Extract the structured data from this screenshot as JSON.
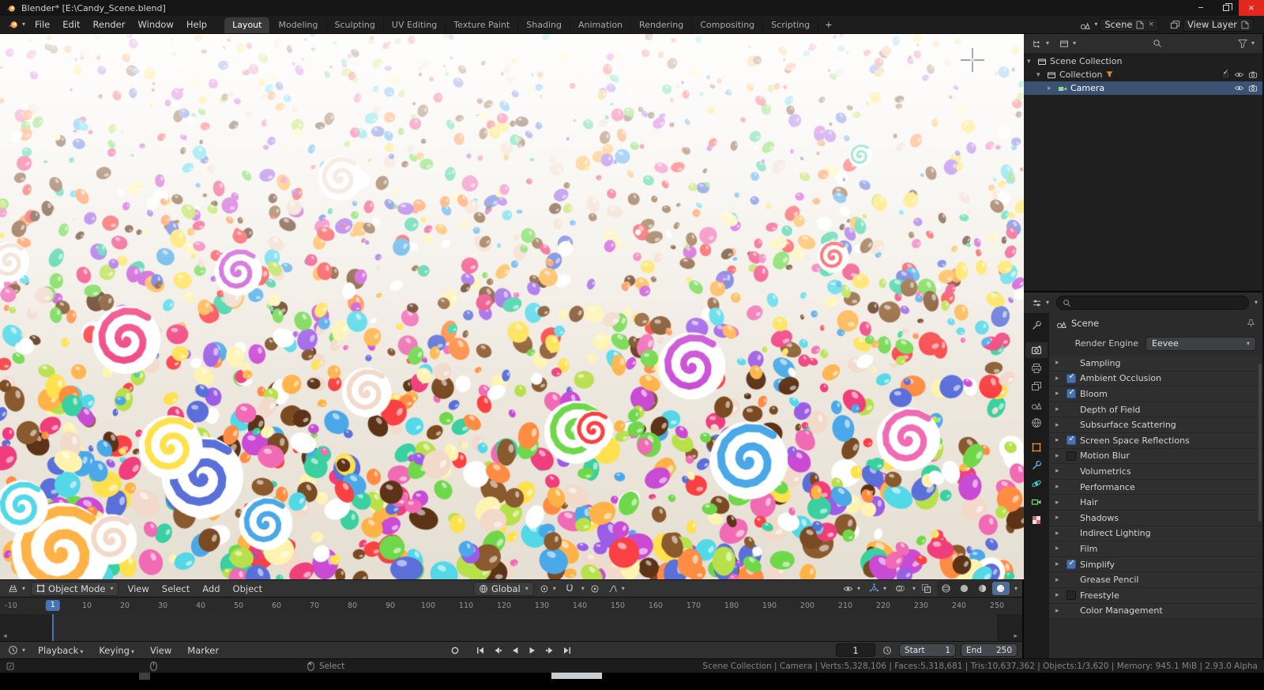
{
  "titlebar": {
    "title": "Blender*  [E:\\Candy_Scene.blend]"
  },
  "menubar": {
    "menus": [
      "File",
      "Edit",
      "Render",
      "Window",
      "Help"
    ],
    "workspaces": [
      {
        "label": "Layout",
        "active": true
      },
      {
        "label": "Modeling"
      },
      {
        "label": "Sculpting"
      },
      {
        "label": "UV Editing"
      },
      {
        "label": "Texture Paint"
      },
      {
        "label": "Shading"
      },
      {
        "label": "Animation"
      },
      {
        "label": "Rendering"
      },
      {
        "label": "Compositing"
      },
      {
        "label": "Scripting"
      }
    ],
    "add_workspace": "+",
    "scene_label": "Scene",
    "view_layer_label": "View Layer"
  },
  "viewport": {
    "header": {
      "mode": "Object Mode",
      "menus": [
        "View",
        "Select",
        "Add",
        "Object"
      ],
      "orientation": "Global"
    },
    "candy_colors": [
      "#ffffff",
      "#fff3b0",
      "#ffe14d",
      "#ffb347",
      "#ff8c42",
      "#f94144",
      "#ef3e7b",
      "#f06bb3",
      "#c94bd4",
      "#9b5de5",
      "#5a6fd8",
      "#4aa8e8",
      "#53d8e8",
      "#3ad0a0",
      "#6fd84a",
      "#b8e04a",
      "#7a4a21",
      "#5d3317",
      "#8a5a2e",
      "#f2d9c9"
    ]
  },
  "timeline": {
    "ticks": [
      -10,
      10,
      20,
      30,
      40,
      50,
      60,
      70,
      80,
      90,
      100,
      110,
      120,
      130,
      140,
      150,
      160,
      170,
      180,
      190,
      200,
      210,
      220,
      230,
      240,
      250
    ],
    "current_frame": 1,
    "frame_display": "1",
    "menus": [
      "Playback",
      "Keying",
      "View",
      "Marker"
    ],
    "start_label": "Start",
    "start_value": "1",
    "end_label": "End",
    "end_value": "250"
  },
  "outliner": {
    "rows": [
      {
        "label": "Scene Collection"
      },
      {
        "label": "Collection"
      },
      {
        "label": "Camera",
        "selected": true
      }
    ]
  },
  "properties": {
    "tabs": [
      "tool",
      "render",
      "output",
      "view-layer",
      "scene",
      "world",
      "object",
      "modifier",
      "physics",
      "object-data",
      "texture"
    ],
    "active_tab": "render",
    "breadcrumb": "Scene",
    "render_engine_label": "Render Engine",
    "render_engine": "Eevee",
    "sections": [
      {
        "label": "Sampling",
        "check": "none"
      },
      {
        "label": "Ambient Occlusion",
        "check": "checked"
      },
      {
        "label": "Bloom",
        "check": "checked"
      },
      {
        "label": "Depth of Field",
        "check": "none"
      },
      {
        "label": "Subsurface Scattering",
        "check": "none"
      },
      {
        "label": "Screen Space Reflections",
        "check": "checked"
      },
      {
        "label": "Motion Blur",
        "check": "unchecked"
      },
      {
        "label": "Volumetrics",
        "check": "none"
      },
      {
        "label": "Performance",
        "check": "none"
      },
      {
        "label": "Hair",
        "check": "none"
      },
      {
        "label": "Shadows",
        "check": "none"
      },
      {
        "label": "Indirect Lighting",
        "check": "none"
      },
      {
        "label": "Film",
        "check": "none"
      },
      {
        "label": "Simplify",
        "check": "checked"
      },
      {
        "label": "Grease Pencil",
        "check": "none"
      },
      {
        "label": "Freestyle",
        "check": "unchecked"
      },
      {
        "label": "Color Management",
        "check": "none"
      }
    ]
  },
  "statusbar": {
    "select_hint": "Select",
    "stats": "Scene Collection | Camera | Verts:5,328,106 | Faces:5,318,681 | Tris:10,637,362 | Objects:1/3,620 | Memory: 945.1 MiB | 2.93.0 Alpha"
  },
  "colors": {
    "accent": "#4772b3"
  }
}
